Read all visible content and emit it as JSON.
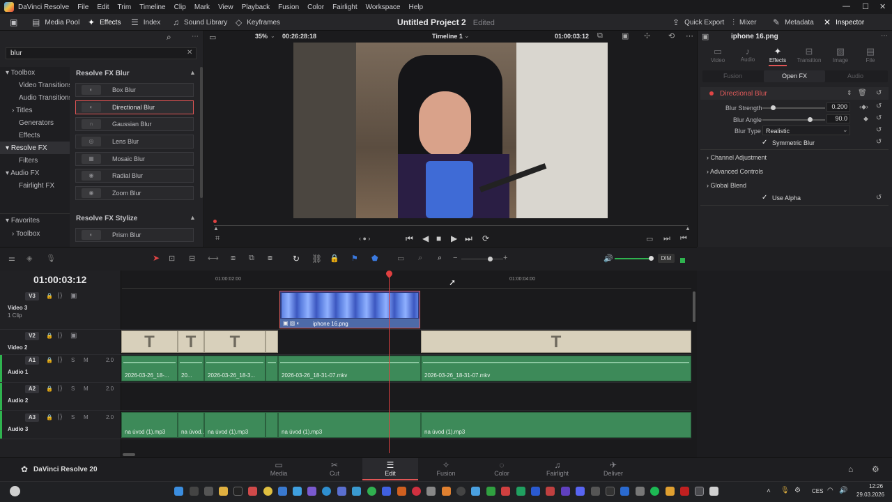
{
  "titlebar": {
    "app_name": "DaVinci Resolve",
    "menu": [
      "File",
      "Edit",
      "Trim",
      "Timeline",
      "Clip",
      "Mark",
      "View",
      "Playback",
      "Fusion",
      "Color",
      "Fairlight",
      "Workspace",
      "Help"
    ],
    "minimize": "—",
    "maximize": "☐",
    "close": "✕"
  },
  "toolbar": {
    "media_pool": "Media Pool",
    "effects": "Effects",
    "index": "Index",
    "sound_library": "Sound Library",
    "keyframes": "Keyframes",
    "project_title": "Untitled Project 2",
    "project_status": "Edited",
    "quick_export": "Quick Export",
    "mixer": "Mixer",
    "metadata": "Metadata",
    "inspector": "Inspector"
  },
  "effects_panel": {
    "search_value": "blur",
    "tree": [
      {
        "label": "Toolbox",
        "expanded": true
      },
      {
        "label": "Video Transitions"
      },
      {
        "label": "Audio Transitions"
      },
      {
        "label": "Titles"
      },
      {
        "label": "Generators"
      },
      {
        "label": "Effects"
      },
      {
        "label": "Resolve FX",
        "selected": true
      },
      {
        "label": "Filters"
      },
      {
        "label": "Audio FX"
      },
      {
        "label": "Fairlight FX"
      }
    ],
    "favorites": "Favorites",
    "favorites_toolbox": "Toolbox",
    "group1": "Resolve FX Blur",
    "items": [
      "Box Blur",
      "Directional Blur",
      "Gaussian Blur",
      "Lens Blur",
      "Mosaic Blur",
      "Radial Blur",
      "Zoom Blur"
    ],
    "selected_item": "Directional Blur",
    "group2": "Resolve FX Stylize",
    "items2": [
      "Prism Blur"
    ]
  },
  "viewer": {
    "zoom": "35%",
    "source_tc": "00:26:28:18",
    "timeline_name": "Timeline 1",
    "timecode": "01:00:03:12"
  },
  "inspector_panel": {
    "clip_name": "iphone 16.png",
    "tabs": [
      "Video",
      "Audio",
      "Effects",
      "Transition",
      "Image",
      "File"
    ],
    "active_tab": "Effects",
    "subtabs": [
      "Fusion",
      "Open FX",
      "Audio"
    ],
    "active_subtab": "Open FX",
    "effect_name": "Directional Blur",
    "params": {
      "blur_strength_label": "Blur Strength",
      "blur_strength": "0.200",
      "blur_strength_level": 0.0,
      "blur_angle_label": "Blur Angle",
      "blur_angle": "90.0",
      "blur_angle_level": 0.75,
      "blur_type_label": "Blur Type",
      "blur_type": "Realistic",
      "symmetric_label": "Symmetric Blur",
      "symmetric": true
    },
    "sections": [
      "Channel Adjustment",
      "Advanced Controls",
      "Global Blend"
    ],
    "use_alpha_label": "Use Alpha",
    "use_alpha": true
  },
  "timeline": {
    "timecode": "01:00:03:12",
    "ruler": [
      "01:00:02:00",
      "01:00:04:00"
    ],
    "dim": "DIM",
    "tracks": [
      {
        "id": "V3",
        "name": "Video 3",
        "sub": "1 Clip"
      },
      {
        "id": "V2",
        "name": "Video 2",
        "sub": ""
      },
      {
        "id": "A1",
        "name": "Audio 1",
        "sub": "",
        "level": "2.0"
      },
      {
        "id": "A2",
        "name": "Audio 2",
        "sub": "",
        "level": "2.0"
      },
      {
        "id": "A3",
        "name": "Audio 3",
        "sub": "",
        "level": "2.0"
      }
    ],
    "v3_clip": "iphone 16.png",
    "title_glyph": "T",
    "a1_clips": [
      "2026-03-26_18-...",
      "20...",
      "2026-03-26_18-3...",
      "2026-03-26_18-31-07.mkv",
      "2026-03-26_18-31-07.mkv"
    ],
    "a3_clips": [
      "na úvod (1).mp3",
      "na úvod...",
      "na úvod (1).mp3",
      "na úvod (1).mp3",
      "na úvod (1).mp3"
    ]
  },
  "pages": [
    "Media",
    "Cut",
    "Edit",
    "Fusion",
    "Color",
    "Fairlight",
    "Deliver"
  ],
  "active_page": "Edit",
  "brand": "DaVinci Resolve 20",
  "taskbar": {
    "lang": "CES",
    "time": "12:26",
    "date": "29.03.2026"
  }
}
